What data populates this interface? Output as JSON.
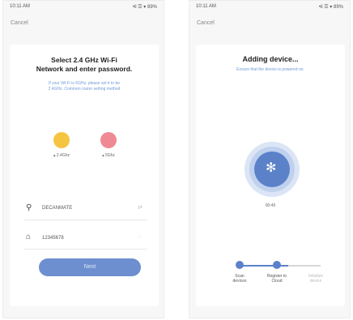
{
  "left_screen": {
    "status": {
      "time": "10:11 AM",
      "icons": "•il ☰ ▾ 89%"
    },
    "cancel_label": "Cancel",
    "title_line1": "Select 2.4 GHz Wi-Fi",
    "title_line2": "Network and enter password.",
    "subtitle_line1": "If your Wi-Fi is 5GHz, please set it to be",
    "subtitle_line2": "2.4GHz. Common router setting method",
    "band_24_label": "2.4Ghz",
    "band_5_label": "5Ghz",
    "band_24_color": "#f5c542",
    "band_5_color": "#ef8a94",
    "ssid_value": "DECANMATE",
    "password_value": "12345678",
    "next_button": "Next",
    "accent_color": "#6d8fcf"
  },
  "right_screen": {
    "status": {
      "time": "10:11 AM",
      "icons": "•il ☰ ▾ 89%"
    },
    "cancel_label": "Cancel",
    "title": "Adding device...",
    "subtitle": "Ensure that the device is powered on.",
    "progress_text": "00:45",
    "steps": [
      {
        "label_line1": "Scan",
        "label_line2": "devices"
      },
      {
        "label_line1": "Register to",
        "label_line2": "Cloud"
      },
      {
        "label_line1": "Initialize",
        "label_line2": "device"
      }
    ],
    "accent_color": "#5b82c9"
  }
}
